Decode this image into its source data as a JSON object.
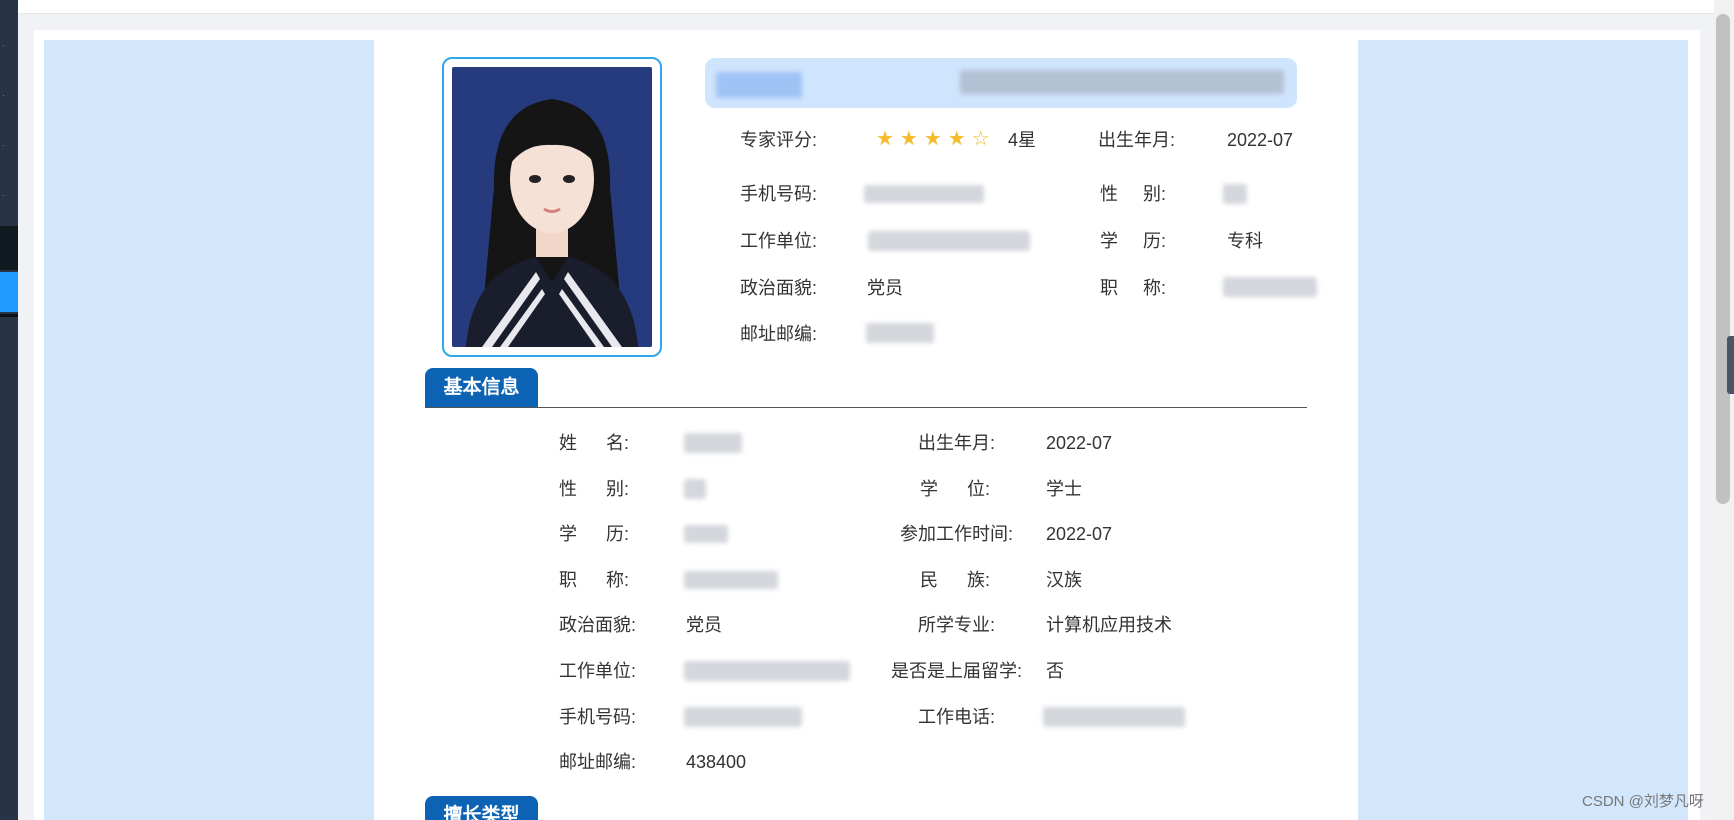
{
  "profile": {
    "rating_label": "专家评分:",
    "rating_value": 4,
    "rating_max": 5,
    "rating_text": "4星",
    "birth_label": "出生年月:",
    "birth_value": "2022-07",
    "phone_label": "手机号码:",
    "gender_label": "性 别:",
    "work_unit_label": "工作单位:",
    "education_label": "学 历:",
    "education_value": "专科",
    "political_label": "政治面貌:",
    "political_value": "党员",
    "title_label": "职 称:",
    "postal_label": "邮址邮编:"
  },
  "basic_info": {
    "section_title": "基本信息",
    "name_label": "姓 名:",
    "birth_label": "出生年月:",
    "birth_value": "2022-07",
    "gender_label": "性 别:",
    "degree_label": "学 位:",
    "degree_value": "学士",
    "education_label": "学 历:",
    "work_start_label": "参加工作时间:",
    "work_start_value": "2022-07",
    "title_label": "职 称:",
    "ethnicity_label": "民 族:",
    "ethnicity_value": "汉族",
    "political_label": "政治面貌:",
    "political_value": "党员",
    "major_label": "所学专业:",
    "major_value": "计算机应用技术",
    "work_unit_label": "工作单位:",
    "overseas_label": "是否是上届留学:",
    "overseas_value": "否",
    "phone_label": "手机号码:",
    "work_phone_label": "工作电话:",
    "postal_label": "邮址邮编:",
    "postal_value": "438400"
  },
  "specialty": {
    "section_title": "擅长类型"
  },
  "watermark": "CSDN @刘梦凡呀",
  "colors": {
    "accent": "#0d63b3",
    "panel_bg": "#d2e6fc",
    "star": "#f7ba2a",
    "frame": "#2fa6e8"
  }
}
